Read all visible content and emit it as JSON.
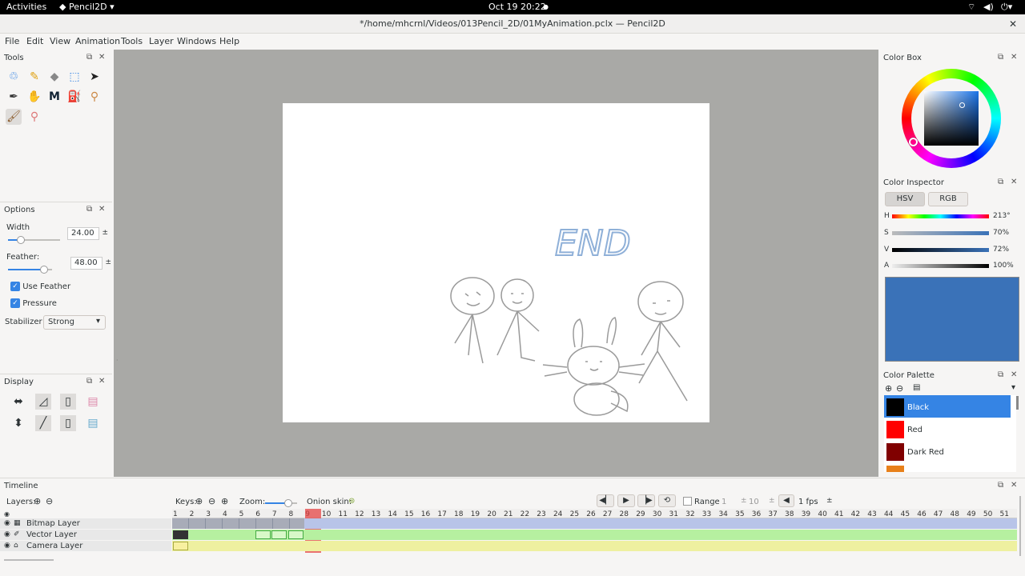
{
  "topbar": {
    "activities": "Activities",
    "app": "Pencil2D",
    "clock": "Oct 19  20:22"
  },
  "window": {
    "title": "*/home/mhcrnl/Videos/013Pencil_2D/01MyAnimation.pclx — Pencil2D"
  },
  "menu": [
    "File",
    "Edit",
    "View",
    "Animation",
    "Tools",
    "Layer",
    "Windows",
    "Help"
  ],
  "tools_panel": {
    "title": "Tools"
  },
  "options_panel": {
    "title": "Options",
    "width_label": "Width",
    "width_value": "24.00",
    "width_level": 0.24,
    "feather_label": "Feather:",
    "feather_value": "48.00",
    "feather_level": 0.48,
    "use_feather": "Use Feather",
    "pressure": "Pressure",
    "stabilizer_label": "Stabilizer",
    "stabilizer_value": "Strong"
  },
  "display_panel": {
    "title": "Display"
  },
  "drawing": {
    "text": "END"
  },
  "color_box": {
    "title": "Color Box"
  },
  "color_inspector": {
    "title": "Color Inspector",
    "tab_hsv": "HSV",
    "tab_rgb": "RGB",
    "h_label": "H",
    "h_value": "213°",
    "s_label": "S",
    "s_value": "70%",
    "v_label": "V",
    "v_value": "72%",
    "a_label": "A",
    "a_value": "100%",
    "current_color": "#3a72b8"
  },
  "color_palette": {
    "title": "Color Palette",
    "items": [
      {
        "name": "Black",
        "color": "#000000"
      },
      {
        "name": "Red",
        "color": "#ff0000"
      },
      {
        "name": "Dark Red",
        "color": "#800000"
      }
    ]
  },
  "timeline": {
    "title": "Timeline",
    "layers_label": "Layers:",
    "keys_label": "Keys:",
    "zoom_label": "Zoom:",
    "onion_label": "Onion skin:",
    "range_label": "Range",
    "range_start": "1",
    "range_end": "10",
    "fps": "1 fps",
    "frames": [
      "1",
      "2",
      "3",
      "4",
      "5",
      "6",
      "7",
      "8",
      "9",
      "10",
      "11",
      "12",
      "13",
      "14",
      "15",
      "16",
      "17",
      "18",
      "19",
      "20",
      "21",
      "22",
      "23",
      "24",
      "25",
      "26",
      "27",
      "28",
      "29",
      "30",
      "31",
      "32",
      "33",
      "34",
      "35",
      "36",
      "37",
      "38",
      "39",
      "40",
      "41",
      "42",
      "43",
      "44",
      "45",
      "46",
      "47",
      "48",
      "49",
      "50",
      "51"
    ],
    "layers": [
      "Bitmap Layer",
      "Vector Layer",
      "Camera Layer"
    ]
  }
}
